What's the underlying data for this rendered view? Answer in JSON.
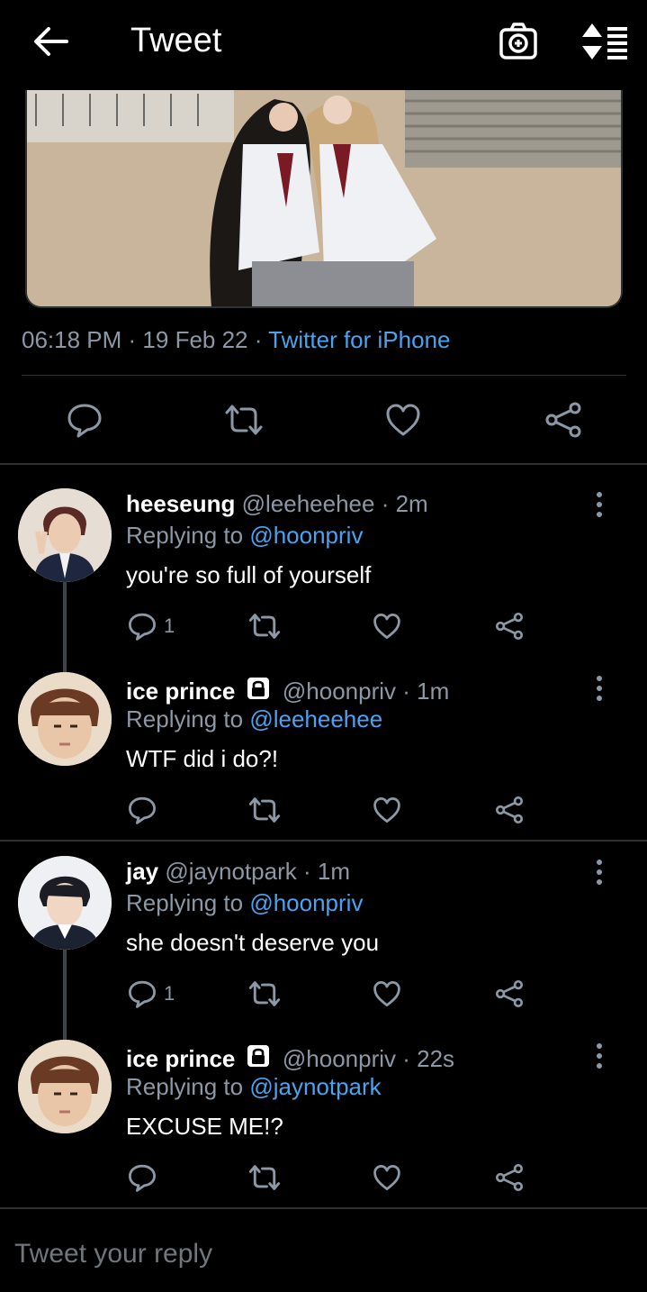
{
  "header": {
    "title": "Tweet"
  },
  "tweet": {
    "time": "06:18 PM",
    "date": "19 Feb 22",
    "source": "Twitter for iPhone"
  },
  "replies": [
    {
      "name": "heeseung",
      "handle": "@leeheehee",
      "age": "2m",
      "locked": false,
      "replying_label": "Replying to",
      "replying_to": "@hoonpriv",
      "text": "you're so full of yourself",
      "reply_count": "1"
    },
    {
      "name": "ice prince",
      "handle": "@hoonpriv",
      "age": "1m",
      "locked": true,
      "replying_label": "Replying to",
      "replying_to": "@leeheehee",
      "text": "WTF did i do?!",
      "reply_count": ""
    },
    {
      "name": "jay",
      "handle": "@jaynotpark",
      "age": "1m",
      "locked": false,
      "replying_label": "Replying to",
      "replying_to": "@hoonpriv",
      "text": "she doesn't deserve you",
      "reply_count": "1"
    },
    {
      "name": "ice prince",
      "handle": "@hoonpriv",
      "age": "22s",
      "locked": true,
      "replying_label": "Replying to",
      "replying_to": "@jaynotpark",
      "text": "EXCUSE ME!?",
      "reply_count": ""
    }
  ],
  "composer": {
    "placeholder": "Tweet your reply"
  },
  "colors": {
    "accent": "#4aa3ef",
    "muted": "#8b98a5",
    "background": "#000000",
    "divider": "#2f3336"
  },
  "icons": [
    "back-arrow-icon",
    "camera-icon",
    "sort-icon",
    "reply-icon",
    "retweet-icon",
    "like-icon",
    "share-icon",
    "more-icon",
    "lock-icon"
  ]
}
